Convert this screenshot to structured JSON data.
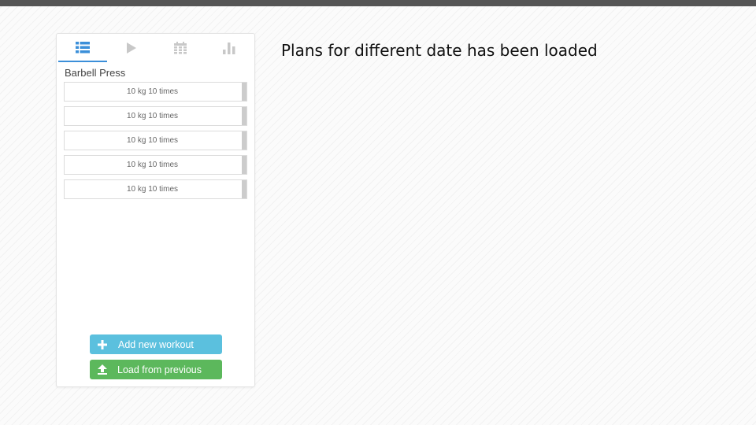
{
  "caption": "Plans for different date has been loaded",
  "tabs": [
    {
      "icon": "list-icon",
      "active": true
    },
    {
      "icon": "play-icon",
      "active": false
    },
    {
      "icon": "calendar-icon",
      "active": false
    },
    {
      "icon": "bar-chart-icon",
      "active": false
    }
  ],
  "colors": {
    "accent": "#3b8fd9",
    "add_button": "#5bc0de",
    "load_button": "#5cb85c",
    "inactive_icon": "#c8c8c8"
  },
  "exercise": {
    "name": "Barbell Press",
    "sets": [
      {
        "label": "10 kg 10 times"
      },
      {
        "label": "10 kg 10 times"
      },
      {
        "label": "10 kg 10 times"
      },
      {
        "label": "10 kg 10 times"
      },
      {
        "label": "10 kg 10 times"
      }
    ]
  },
  "buttons": {
    "add_label": "Add new workout",
    "load_label": "Load from previous"
  }
}
